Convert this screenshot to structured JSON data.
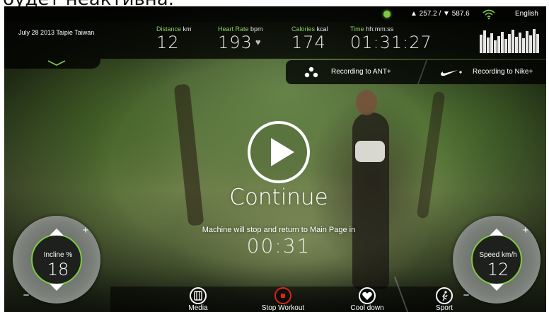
{
  "page_heading_fragment": "будет неактивна.",
  "status_bar": {
    "elevation": "▲ 257.2 / ▼ 587.6",
    "language": "English",
    "colors": {
      "indicator": "#7ec840"
    },
    "icons": [
      "status-led-icon",
      "wifi-icon"
    ]
  },
  "header": {
    "date_location": "July 28 2013  Taipie Taiwan",
    "metrics": [
      {
        "label": "Distance",
        "unit": "km",
        "value": "12"
      },
      {
        "label": "Heart Rate",
        "unit": "bpm",
        "value": "193"
      },
      {
        "label": "Calories",
        "unit": "kcal",
        "value": "174"
      },
      {
        "label": "Time",
        "unit": "hh:mm:ss",
        "value": "01:31:27"
      }
    ],
    "accent_color": "#8ed05a"
  },
  "recording": {
    "ant_label": "Recording to ANT+",
    "nike_label": "Recording to Nike+"
  },
  "pause_screen": {
    "continue_label": "Continue",
    "stop_message": "Machine will stop and return to Main Page in",
    "countdown": "00:31"
  },
  "incline": {
    "label": "Incline",
    "unit": "%",
    "value": "18",
    "plus": "+",
    "minus": "−"
  },
  "speed": {
    "label": "Speed",
    "unit": "km/h",
    "value": "12",
    "plus": "+",
    "minus": "−"
  },
  "toolbar": [
    {
      "label": "Media",
      "icon": "media-icon"
    },
    {
      "label": "Stop Workout",
      "icon": "stop-icon",
      "color": "#e02020"
    },
    {
      "label": "Cool down",
      "icon": "heart-icon"
    },
    {
      "label": "Sport",
      "icon": "runner-icon"
    }
  ]
}
